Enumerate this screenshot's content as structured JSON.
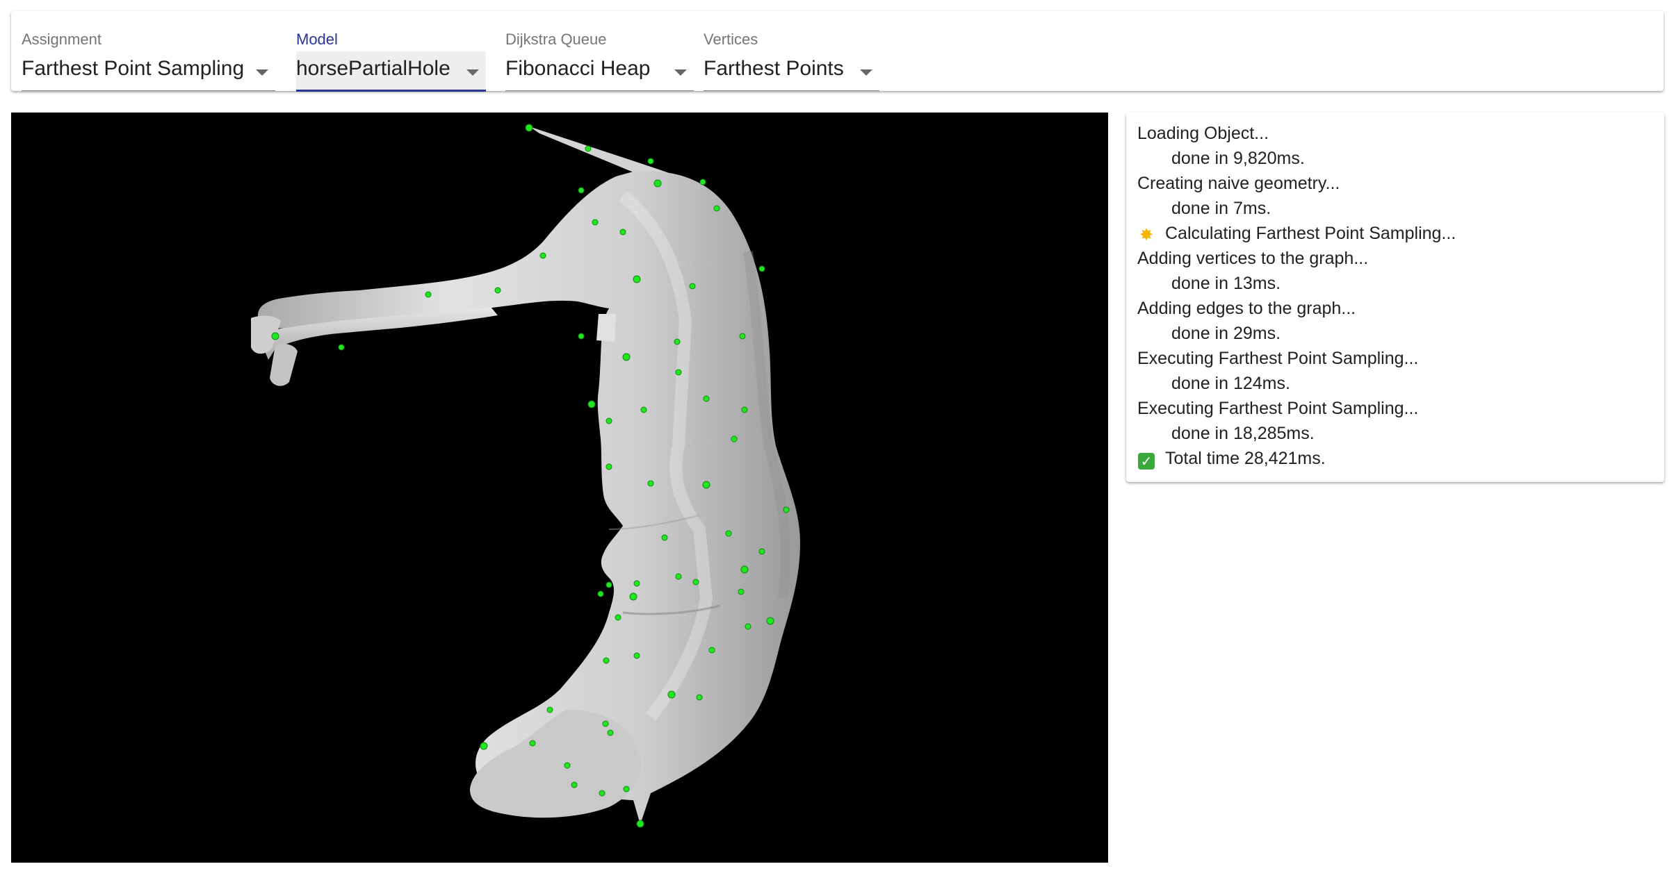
{
  "toolbar": {
    "assignment": {
      "label": "Assignment",
      "value": "Farthest Point Sampling"
    },
    "model": {
      "label": "Model",
      "value": "horsePartialHole"
    },
    "queue": {
      "label": "Dijkstra Queue",
      "value": "Fibonacci Heap"
    },
    "vertices": {
      "label": "Vertices",
      "value": "Farthest Points"
    }
  },
  "viewport": {
    "background": "#000000",
    "mesh_color": "#d9d9d9",
    "sample_point_color": "#22e622",
    "sample_point_count": 60
  },
  "log": {
    "lines": [
      {
        "text": "Loading Object...",
        "icon": ""
      },
      {
        "text": "done in 9,820ms.",
        "icon": ""
      },
      {
        "text": "Creating naive geometry...",
        "icon": ""
      },
      {
        "text": "done in 7ms.",
        "icon": ""
      },
      {
        "text": "Calculating Farthest Point Sampling...",
        "icon": "sparkle-icon"
      },
      {
        "text": "Adding vertices to the graph...",
        "icon": ""
      },
      {
        "text": "done in 13ms.",
        "icon": ""
      },
      {
        "text": "Adding edges to the graph...",
        "icon": ""
      },
      {
        "text": "done in 29ms.",
        "icon": ""
      },
      {
        "text": "Executing Farthest Point Sampling...",
        "icon": ""
      },
      {
        "text": "done in 124ms.",
        "icon": ""
      },
      {
        "text": "Executing Farthest Point Sampling...",
        "icon": ""
      },
      {
        "text": "done in 18,285ms.",
        "icon": ""
      },
      {
        "text": "Total time 28,421ms.",
        "icon": "check-icon"
      }
    ]
  },
  "colors": {
    "accent": "#283593",
    "check_green": "#3aa83a",
    "sparkle": "#f4b400"
  }
}
